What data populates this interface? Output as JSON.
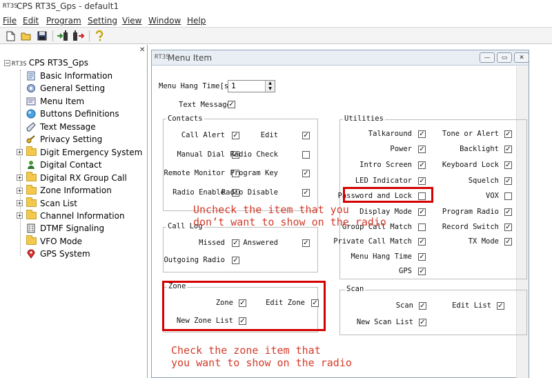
{
  "app": {
    "logo_text": "RT3S",
    "window_title": "CPS RT3S_Gps - default1"
  },
  "menubar": {
    "items": [
      "File",
      "Edit",
      "Program",
      "Setting",
      "View",
      "Window",
      "Help"
    ]
  },
  "toolbar": {
    "icons": [
      "new-file-icon",
      "open-folder-icon",
      "save-icon",
      "read-radio-icon",
      "write-radio-icon",
      "help-icon"
    ]
  },
  "tree": {
    "root": "CPS RT3S_Gps",
    "items": [
      {
        "label": "Basic Information",
        "icon": "basic-info-icon",
        "expandable": false
      },
      {
        "label": "General Setting",
        "icon": "gear-icon",
        "expandable": false
      },
      {
        "label": "Menu Item",
        "icon": "menu-item-icon",
        "expandable": false
      },
      {
        "label": "Buttons Definitions",
        "icon": "button-icon",
        "expandable": false
      },
      {
        "label": "Text Message",
        "icon": "message-icon",
        "expandable": false
      },
      {
        "label": "Privacy Setting",
        "icon": "key-icon",
        "expandable": false
      },
      {
        "label": "Digit Emergency System",
        "icon": "folder-icon",
        "expandable": true
      },
      {
        "label": "Digital Contact",
        "icon": "contact-icon",
        "expandable": false
      },
      {
        "label": "Digital RX Group Call",
        "icon": "folder-icon",
        "expandable": true
      },
      {
        "label": "Zone Information",
        "icon": "folder-icon",
        "expandable": true
      },
      {
        "label": "Scan List",
        "icon": "folder-icon",
        "expandable": true
      },
      {
        "label": "Channel Information",
        "icon": "folder-icon",
        "expandable": true
      },
      {
        "label": "DTMF Signaling",
        "icon": "dtmf-icon",
        "expandable": false
      },
      {
        "label": "VFO Mode",
        "icon": "folder-icon",
        "expandable": false
      },
      {
        "label": "GPS System",
        "icon": "gps-icon",
        "expandable": false
      }
    ]
  },
  "child_window": {
    "logo_text": "RT3S",
    "title": "Menu Item",
    "menu_hang_time_label": "Menu Hang Time[s]",
    "menu_hang_time_value": "1",
    "text_message_label": "Text Message",
    "text_message_checked": true,
    "contacts": {
      "label": "Contacts",
      "items": [
        {
          "label": "Call Alert",
          "checked": true
        },
        {
          "label": "Edit",
          "checked": true
        },
        {
          "label": "Manual Dial",
          "checked": true
        },
        {
          "label": "Radio Check",
          "checked": false
        },
        {
          "label": "Remote Monitor",
          "checked": false
        },
        {
          "label": "Program Key",
          "checked": true
        },
        {
          "label": "Radio Enable",
          "checked": true
        },
        {
          "label": "Radio Disable",
          "checked": true
        }
      ]
    },
    "call_log": {
      "label": "Call Log",
      "items": [
        {
          "label": "Missed",
          "checked": true
        },
        {
          "label": "Answered",
          "checked": true
        },
        {
          "label": "Outgoing Radio",
          "checked": true
        }
      ]
    },
    "zone": {
      "label": "Zone",
      "items": [
        {
          "label": "Zone",
          "checked": true
        },
        {
          "label": "Edit Zone",
          "checked": true
        },
        {
          "label": "New Zone List",
          "checked": true
        }
      ]
    },
    "utilities": {
      "label": "Utilities",
      "items": [
        {
          "label": "Talkaround",
          "checked": true
        },
        {
          "label": "Tone or Alert",
          "checked": true
        },
        {
          "label": "Power",
          "checked": true
        },
        {
          "label": "Backlight",
          "checked": true
        },
        {
          "label": "Intro Screen",
          "checked": true
        },
        {
          "label": "Keyboard Lock",
          "checked": true
        },
        {
          "label": "LED Indicator",
          "checked": true
        },
        {
          "label": "Squelch",
          "checked": true
        },
        {
          "label": "Password and Lock",
          "checked": false
        },
        {
          "label": "VOX",
          "checked": false
        },
        {
          "label": "Display Mode",
          "checked": true
        },
        {
          "label": "Program Radio",
          "checked": true
        },
        {
          "label": "Group Call Match",
          "checked": false
        },
        {
          "label": "Record Switch",
          "checked": true
        },
        {
          "label": "Private Call Match",
          "checked": true
        },
        {
          "label": "TX Mode",
          "checked": true
        },
        {
          "label": "Menu Hang Time",
          "checked": true
        },
        {
          "label": "GPS",
          "checked": true
        }
      ]
    },
    "scan": {
      "label": "Scan",
      "items": [
        {
          "label": "Scan",
          "checked": true
        },
        {
          "label": "Edit List",
          "checked": true
        },
        {
          "label": "New Scan List",
          "checked": true
        }
      ]
    }
  },
  "annotations": {
    "note1_line1": "Uncheck the item that you",
    "note1_line2": "don’t want to show on the radio",
    "note2_line1": "Check the zone item that",
    "note2_line2": "you want to show on the radio",
    "highlight_color": "#d40000",
    "note_color": "#d43b2a"
  }
}
